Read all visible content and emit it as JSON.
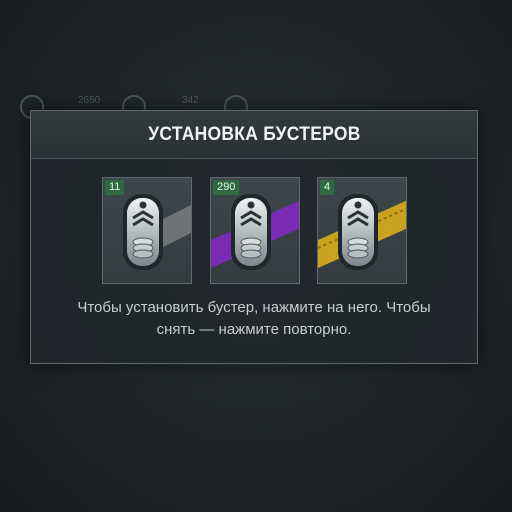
{
  "background": {
    "numbers": [
      "2650",
      "342"
    ]
  },
  "dialog": {
    "title": "УСТАНОВКА БУСТЕРОВ",
    "hint_line1": "Чтобы установить бустер, нажмите на него. Чтобы",
    "hint_line2": "снять — нажмите повторно."
  },
  "boosters": [
    {
      "count": "11",
      "ribbon_color": "#9c9c9c",
      "name": "booster-common"
    },
    {
      "count": "290",
      "ribbon_color": "#7a2bb3",
      "name": "booster-rare"
    },
    {
      "count": "4",
      "ribbon_color": "#c9a320",
      "name": "booster-legendary"
    }
  ],
  "colors": {
    "count_badge": "#2d6a3f",
    "panel_border": "#5d676b"
  }
}
